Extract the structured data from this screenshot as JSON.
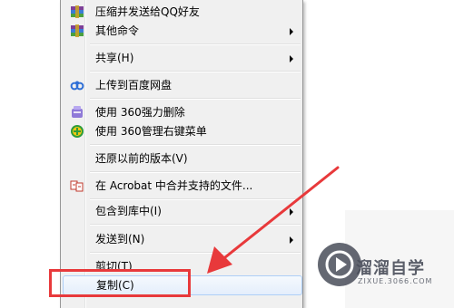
{
  "context_menu": {
    "items": [
      {
        "label": "压缩并发送给QQ好友",
        "icon": "winrar-archive-icon",
        "submenu": false
      },
      {
        "label": "其他命令",
        "icon": "winrar-archive-icon",
        "submenu": true
      },
      {
        "label": "共享(H)",
        "icon": "",
        "submenu": true
      },
      {
        "label": "上传到百度网盘",
        "icon": "baidu-netdisk-icon",
        "submenu": false
      },
      {
        "label": "使用 360强力删除",
        "icon": "360-force-delete-icon",
        "submenu": false
      },
      {
        "label": "使用 360管理右键菜单",
        "icon": "360-menu-manager-icon",
        "submenu": false
      },
      {
        "label": "还原以前的版本(V)",
        "icon": "",
        "submenu": false
      },
      {
        "label": "在 Acrobat 中合并支持的文件...",
        "icon": "acrobat-combine-icon",
        "submenu": false
      },
      {
        "label": "包含到库中(I)",
        "icon": "",
        "submenu": true
      },
      {
        "label": "发送到(N)",
        "icon": "",
        "submenu": true
      },
      {
        "label": "剪切(T)",
        "icon": "",
        "submenu": false
      },
      {
        "label": "复制(C)",
        "icon": "",
        "submenu": false,
        "hovered": true
      }
    ]
  },
  "annotation": {
    "highlight_color": "#e8393b",
    "highlighted_item": "复制(C)"
  },
  "watermark": {
    "title": "溜溜自学",
    "subtitle": "ZIXUE.3066.COM"
  }
}
